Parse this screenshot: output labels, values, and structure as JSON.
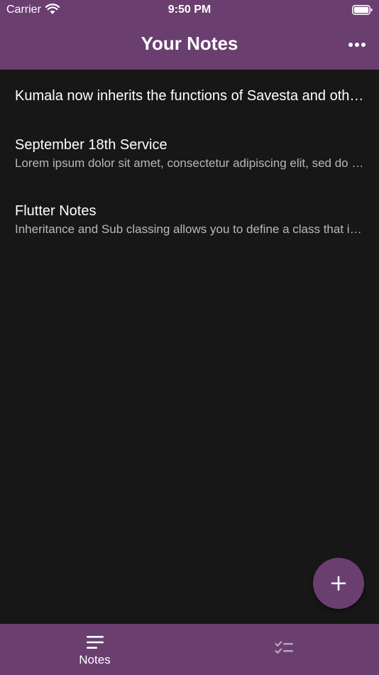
{
  "status_bar": {
    "carrier": "Carrier",
    "time": "9:50 PM"
  },
  "app_bar": {
    "title": "Your Notes",
    "more_icon": "more-horizontal-icon"
  },
  "notes": [
    {
      "title": "Kumala now inherits the functions of  Savesta and other classes",
      "body": ""
    },
    {
      "title": "September 18th Service",
      "body": "Lorem ipsum dolor sit amet, consectetur adipiscing elit, sed do eiusmod tempor"
    },
    {
      "title": "Flutter Notes",
      "body": "Inheritance and Sub classing allows you to define a class that inherits"
    }
  ],
  "fab": {
    "icon": "plus-icon"
  },
  "bottom_nav": {
    "items": [
      {
        "label": "Notes",
        "icon": "notes-icon",
        "active": true
      },
      {
        "label": "",
        "icon": "checklist-icon",
        "active": false
      }
    ]
  },
  "colors": {
    "primary": "#6a3f70",
    "background": "#181718",
    "text": "#ffffff",
    "secondary_text": "#b9b7b9"
  }
}
